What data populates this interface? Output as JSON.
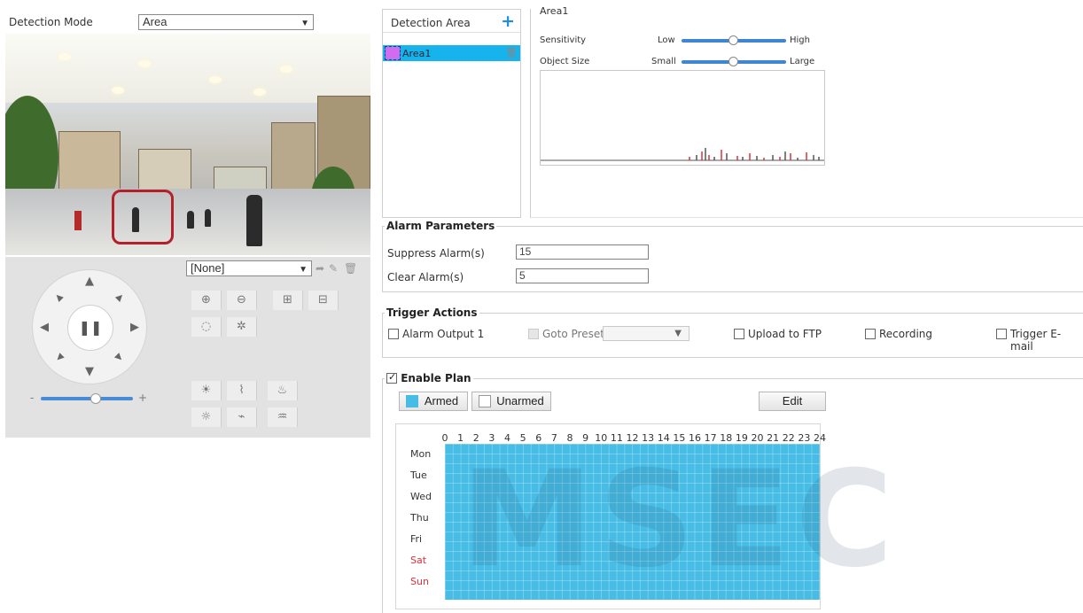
{
  "detection": {
    "label": "Detection Mode",
    "mode": "Area"
  },
  "ptz": {
    "preset_value": "[None]"
  },
  "areas": {
    "header": "Detection Area",
    "items": [
      {
        "label": "Area1"
      }
    ]
  },
  "area_detail": {
    "title": "Area1",
    "sensitivity": {
      "label": "Sensitivity",
      "low": "Low",
      "high": "High",
      "value": 0.5
    },
    "object_size": {
      "label": "Object Size",
      "small": "Small",
      "large": "Large",
      "value": 0.5
    }
  },
  "alarm": {
    "legend": "Alarm Parameters",
    "suppress_label": "Suppress Alarm(s)",
    "suppress_value": "15",
    "clear_label": "Clear Alarm(s)",
    "clear_value": "5"
  },
  "trigger": {
    "legend": "Trigger Actions",
    "alarm_output": "Alarm Output 1",
    "goto_preset": "Goto Preset",
    "upload_ftp": "Upload to FTP",
    "recording": "Recording",
    "email": "Trigger E-mail"
  },
  "plan": {
    "legend": "Enable Plan",
    "armed": "Armed",
    "unarmed": "Unarmed",
    "edit": "Edit",
    "hours": [
      "0",
      "1",
      "2",
      "3",
      "4",
      "5",
      "6",
      "7",
      "8",
      "9",
      "10",
      "11",
      "12",
      "13",
      "14",
      "15",
      "16",
      "17",
      "18",
      "19",
      "20",
      "21",
      "22",
      "23",
      "24"
    ],
    "days": [
      "Mon",
      "Tue",
      "Wed",
      "Thu",
      "Fri",
      "Sat",
      "Sun"
    ],
    "armed_color": "#47bde6",
    "weekend_color": "#e0303c"
  },
  "watermark": "MSEC"
}
